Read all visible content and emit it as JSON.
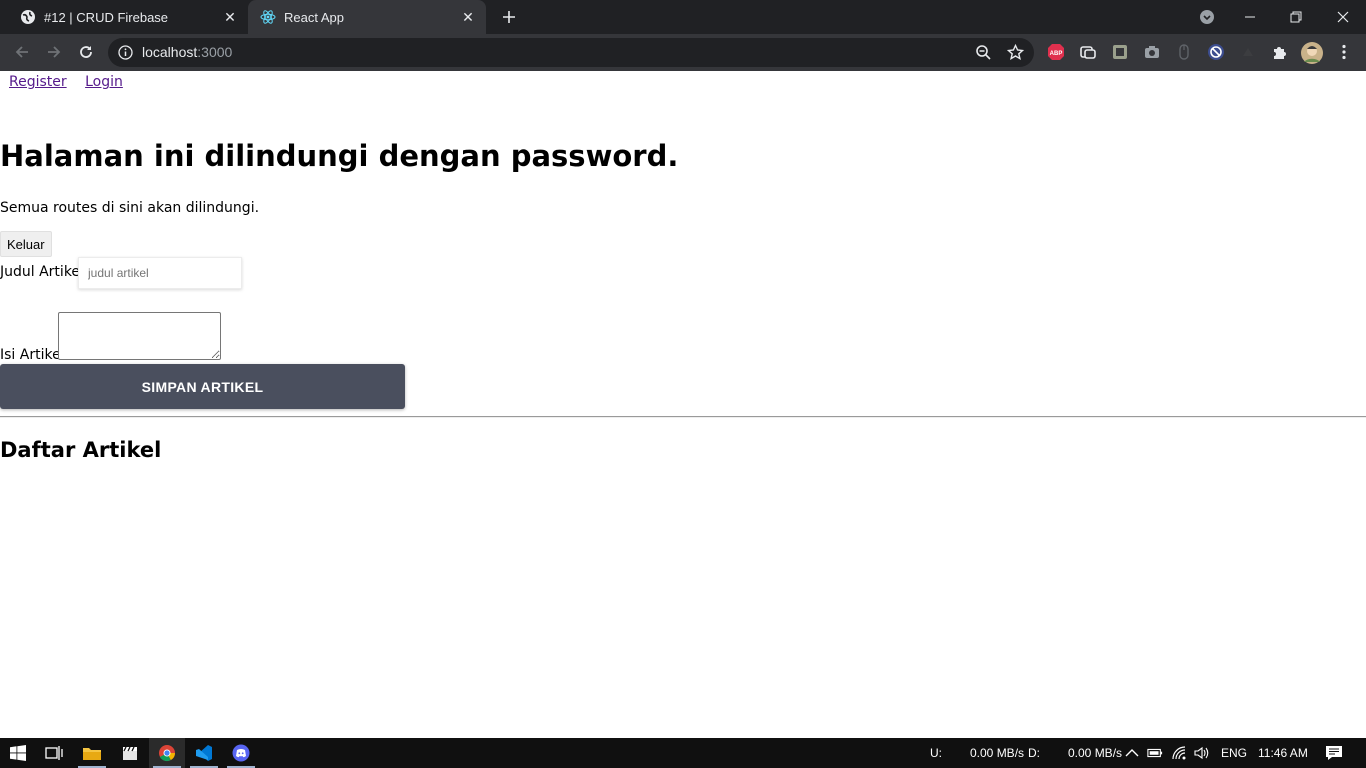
{
  "browser": {
    "tabs": [
      {
        "title": "#12 | CRUD Firebase",
        "active": false,
        "favicon": "globe-icon"
      },
      {
        "title": "React App",
        "active": true,
        "favicon": "react-icon"
      }
    ],
    "omnibox": {
      "host": "localhost",
      "port": ":3000"
    },
    "extensions": [
      "abp-icon",
      "extension-icon",
      "screenshot-icon",
      "camera-icon",
      "mouse-icon",
      "block-icon",
      "puzzle-icon",
      "avatar"
    ]
  },
  "page": {
    "nav": {
      "register": "Register",
      "login": "Login"
    },
    "heading": "Halaman ini dilindungi dengan password.",
    "description": "Semua routes di sini akan dilindungi.",
    "logout_label": "Keluar",
    "form": {
      "title_label": "Judul Artikel",
      "title_placeholder": "judul artikel",
      "title_value": "",
      "content_label": "Isi Artikel",
      "content_value": "",
      "save_label": "SIMPAN ARTIKEL"
    },
    "list_heading": "Daftar Artikel"
  },
  "taskbar": {
    "upload_label": "U:",
    "upload_value": "0.00 MB/s",
    "download_label": "D:",
    "download_value": "0.00 MB/s",
    "language": "ENG",
    "time": "11:46 AM"
  }
}
